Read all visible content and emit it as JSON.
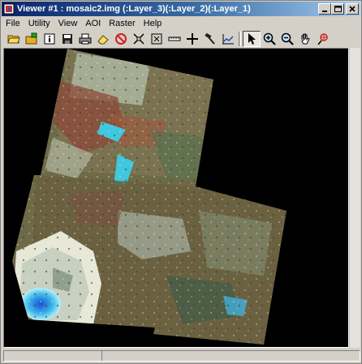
{
  "window": {
    "title": "Viewer #1 : mosaic2.img (:Layer_3)(:Layer_2)(:Layer_1)"
  },
  "menu": [
    "File",
    "Utility",
    "View",
    "AOI",
    "Raster",
    "Help"
  ],
  "toolbar": {
    "icons": [
      "open-folder-icon",
      "open-layer-icon",
      "info-icon",
      "save-icon",
      "print-icon",
      "eraser-icon",
      "clear-icon",
      "scale-icon",
      "fit-icon",
      "measure-icon",
      "crosshair-icon",
      "hammer-icon",
      "profile-icon",
      "pointer-icon",
      "zoom-in-icon",
      "zoom-out-icon",
      "pan-icon",
      "inquire-icon"
    ],
    "active_tool": "pointer-icon"
  },
  "colors": {
    "title_start": "#0a246a",
    "viewer_bg": "#000000",
    "window_bg": "#d4d0c8"
  }
}
